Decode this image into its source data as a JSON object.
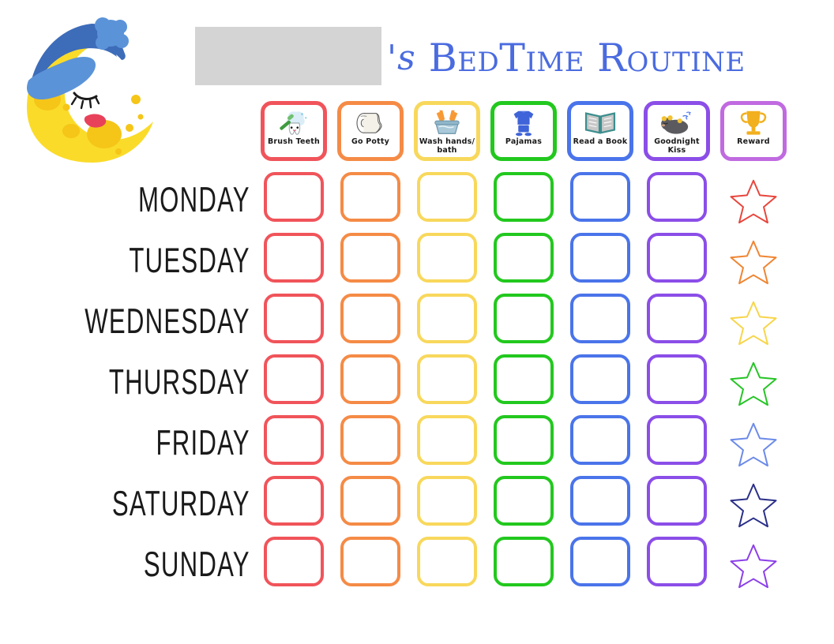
{
  "title": {
    "possessive_suffix": "'s",
    "main_text": "BedTime Routine",
    "name_placeholder_value": "",
    "color": "#4a6be0"
  },
  "decoration": {
    "moon_icon": "sleeping-crescent-moon-with-nightcap",
    "moon_colors": {
      "body": "#fadb2a",
      "crater": "#f5c518",
      "cap": "#3d6cb9",
      "cap_brim": "#5b93d8",
      "mouth": "#e8425a"
    }
  },
  "chart_data": {
    "type": "table",
    "title": "BedTime Routine",
    "rows": [
      "MONDAY",
      "TUESDAY",
      "WEDNESDAY",
      "THURSDAY",
      "FRIDAY",
      "SATURDAY",
      "SUNDAY"
    ],
    "columns": [
      {
        "label": "Brush Teeth",
        "icon": "toothbrush-tooth-icon",
        "color": "#f0545a"
      },
      {
        "label": "Go Potty",
        "icon": "toilet-paper-icon",
        "color": "#f58b46"
      },
      {
        "label": "Wash hands/ bath",
        "icon": "hands-washing-basin-icon",
        "color": "#f8d85c"
      },
      {
        "label": "Pajamas",
        "icon": "pajamas-icon",
        "color": "#22c81e"
      },
      {
        "label": "Read a Book",
        "icon": "open-book-icon",
        "color": "#4a74ea"
      },
      {
        "label": "Goodnight Kiss",
        "icon": "sleeping-bear-icon",
        "color": "#8b4ee8"
      },
      {
        "label": "Reward",
        "icon": "trophy-icon",
        "color": "#c06ae0"
      }
    ],
    "star_colors": [
      "#e8453c",
      "#ef8532",
      "#f7d54a",
      "#25c425",
      "#6b8ae8",
      "#2a2f88",
      "#8b3fe8"
    ],
    "cells_checked": false,
    "grid_rows": 7,
    "grid_columns": 6
  }
}
